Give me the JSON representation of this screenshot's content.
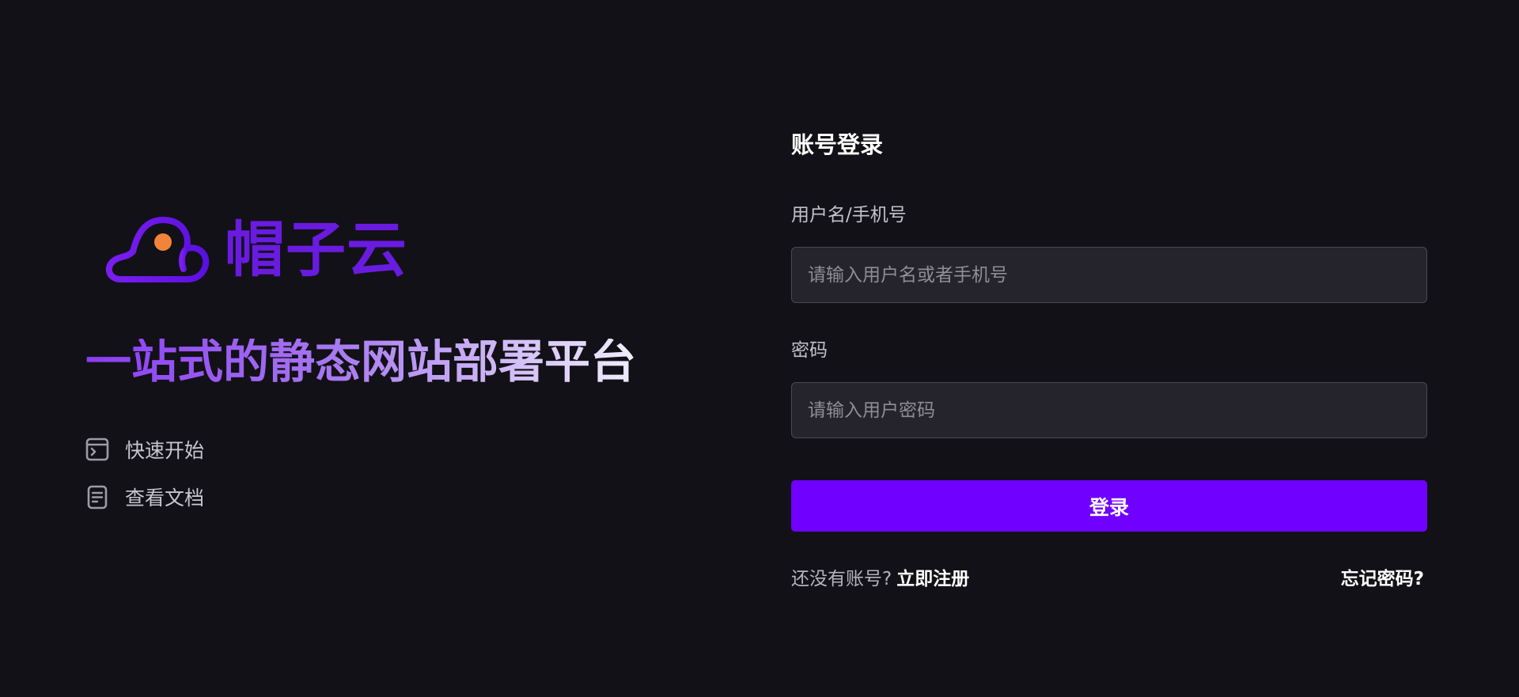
{
  "brand": {
    "name": "帽子云",
    "logo_icon": "cloud-icon",
    "colors": {
      "logo_stroke": "#6a1be0",
      "logo_dot": "#f2843a"
    }
  },
  "slogan": "一站式的静态网站部署平台",
  "links": [
    {
      "label": "快速开始",
      "icon": "terminal-icon"
    },
    {
      "label": "查看文档",
      "icon": "document-icon"
    }
  ],
  "login": {
    "title": "账号登录",
    "username": {
      "label": "用户名/手机号",
      "placeholder": "请输入用户名或者手机号",
      "value": ""
    },
    "password": {
      "label": "密码",
      "placeholder": "请输入用户密码",
      "value": ""
    },
    "submit_label": "登录",
    "no_account_text": "还没有账号?",
    "register_label": "立即注册",
    "forgot_label": "忘记密码?"
  },
  "colors": {
    "background": "#121117",
    "accent": "#7000ff",
    "input_bg": "#25242d"
  }
}
